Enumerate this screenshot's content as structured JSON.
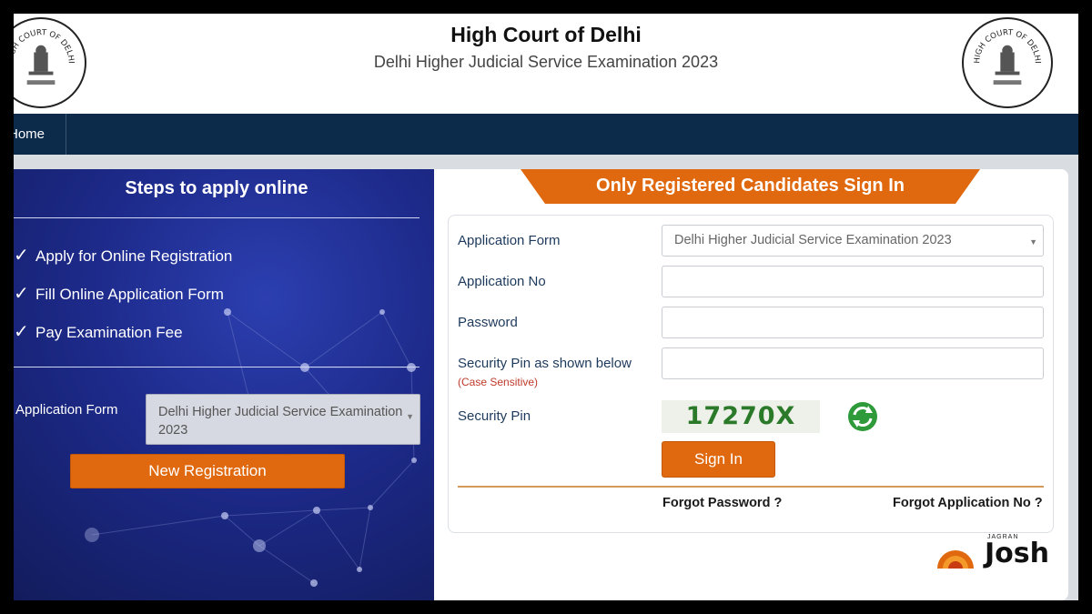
{
  "header": {
    "title": "High Court of Delhi",
    "subtitle": "Delhi Higher Judicial Service Examination 2023",
    "emblem_text": "HIGH COURT OF DELHI"
  },
  "nav": {
    "home_label": "Home"
  },
  "left_panel": {
    "title": "Steps to apply online",
    "steps": [
      "Apply for Online Registration",
      "Fill Online Application Form",
      "Pay Examination Fee"
    ],
    "application_form_label": "Application Form",
    "application_form_value": "Delhi Higher Judicial Service Examination 2023",
    "new_registration_label": "New Registration"
  },
  "sign_in": {
    "title": "Only Registered Candidates Sign In",
    "application_form_label": "Application Form",
    "application_form_value": "Delhi Higher Judicial Service Examination 2023",
    "application_no_label": "Application No",
    "application_no_value": "",
    "password_label": "Password",
    "password_value": "",
    "security_pin_input_label": "Security Pin as shown below",
    "case_note": "(Case Sensitive)",
    "security_pin_input_value": "",
    "security_pin_label": "Security Pin",
    "captcha_text": "17270X",
    "sign_in_label": "Sign In",
    "forgot_password_label": "Forgot Password ?",
    "forgot_application_label": "Forgot Application No ?"
  },
  "watermark": {
    "small_text": "JAGRAN",
    "brand_text": "Josh"
  },
  "colors": {
    "nav_bg": "#0c2a4a",
    "accent_orange": "#e0680e",
    "label_blue": "#1d3a5c",
    "captcha_green": "#2a7a2a"
  }
}
